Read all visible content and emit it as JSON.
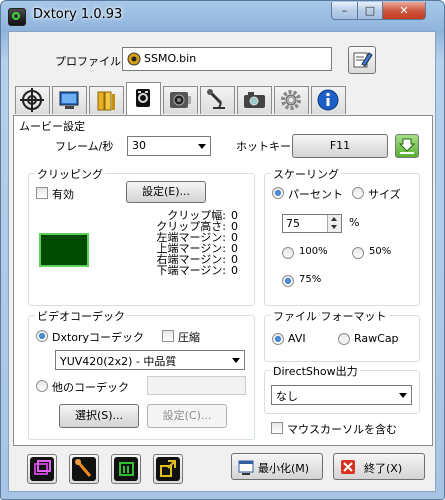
{
  "window": {
    "title": "Dxtory 1.0.93",
    "min": "–",
    "max": "□",
    "close": "✕"
  },
  "profile": {
    "label": "プロファイル",
    "value": "SSMO.bin"
  },
  "tabs": [
    {
      "icon": "crosshair-icon"
    },
    {
      "icon": "monitor-icon"
    },
    {
      "icon": "folder-icon"
    },
    {
      "icon": "movie-icon",
      "active": true
    },
    {
      "icon": "audio-icon"
    },
    {
      "icon": "microphone-icon"
    },
    {
      "icon": "camera-icon"
    },
    {
      "icon": "gear-icon"
    },
    {
      "icon": "info-icon"
    }
  ],
  "movie": {
    "section": "ムービー設定",
    "fps_label": "フレーム/秒",
    "fps_value": "30",
    "hotkey_label": "ホットキー",
    "hotkey_value": "F11"
  },
  "clipping": {
    "title": "クリッピング",
    "enable": "有効",
    "settings_button": "設定(E)...",
    "fields": [
      {
        "label": "クリップ幅:",
        "value": "0"
      },
      {
        "label": "クリップ高さ:",
        "value": "0"
      },
      {
        "label": "左端マージン:",
        "value": "0"
      },
      {
        "label": "上端マージン:",
        "value": "0"
      },
      {
        "label": "右端マージン:",
        "value": "0"
      },
      {
        "label": "下端マージン:",
        "value": "0"
      }
    ],
    "preview_color": "#004a00"
  },
  "scaling": {
    "title": "スケーリング",
    "percent": "パーセント",
    "size": "サイズ",
    "percent_value": "75",
    "unit": "%",
    "opt100": "100%",
    "opt50": "50%",
    "opt75": "75%"
  },
  "codec": {
    "title": "ビデオコーデック",
    "dxtory": "Dxtoryコーデック",
    "compress": "圧縮",
    "format": "YUV420(2x2) - 中品質",
    "other": "他のコーデック",
    "select_button": "選択(S)...",
    "settings_button": "設定(C)..."
  },
  "file_format": {
    "title": "ファイル フォーマット",
    "avi": "AVI",
    "rawcap": "RawCap"
  },
  "directshow": {
    "title": "DirectShow出力",
    "value": "なし"
  },
  "mouse_cursor": "マウスカーソルを含む",
  "bottom": {
    "minimize": "最小化(M)",
    "exit": "終了(X)"
  }
}
